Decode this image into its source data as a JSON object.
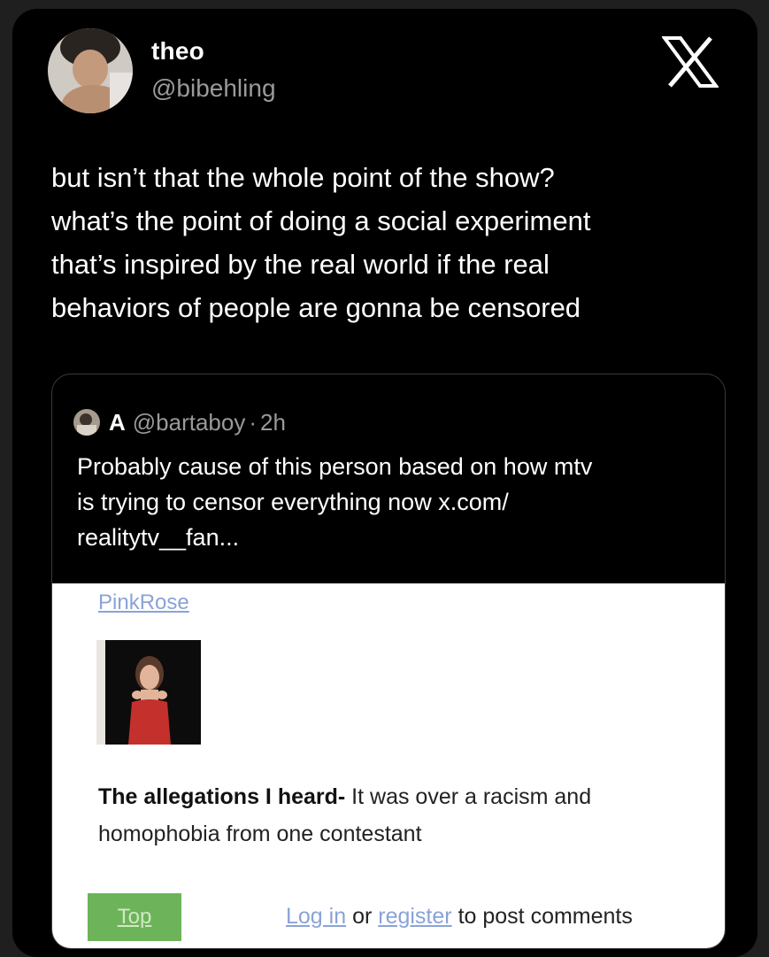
{
  "author": {
    "name": "theo",
    "handle": "@bibehling"
  },
  "platform_logo": "x-logo-icon",
  "tweet_text": "but isn’t that the whole point of the show?\nwhat’s the point of doing a social experiment\nthat’s inspired by the real world if the real\nbehaviors of people are gonna be censored",
  "quote": {
    "name": "A",
    "handle": "@bartaboy",
    "separator": "·",
    "time": "2h",
    "text": "Probably cause of this person based on how mtv\nis trying to censor everything now x.com/\nrealitytv__fan..."
  },
  "webpage": {
    "link_title": "PinkRose",
    "bold_prefix": "The allegations I heard-",
    "body": " It was over a racism and homophobia from one contestant",
    "top_button": "Top",
    "login": "Log in",
    "or": " or ",
    "register": "register",
    "suffix": " to post comments"
  },
  "colors": {
    "background": "#000000",
    "text": "#ffffff",
    "muted": "#9a9a9a",
    "link": "#8aa3d6",
    "button": "#6db35a"
  }
}
